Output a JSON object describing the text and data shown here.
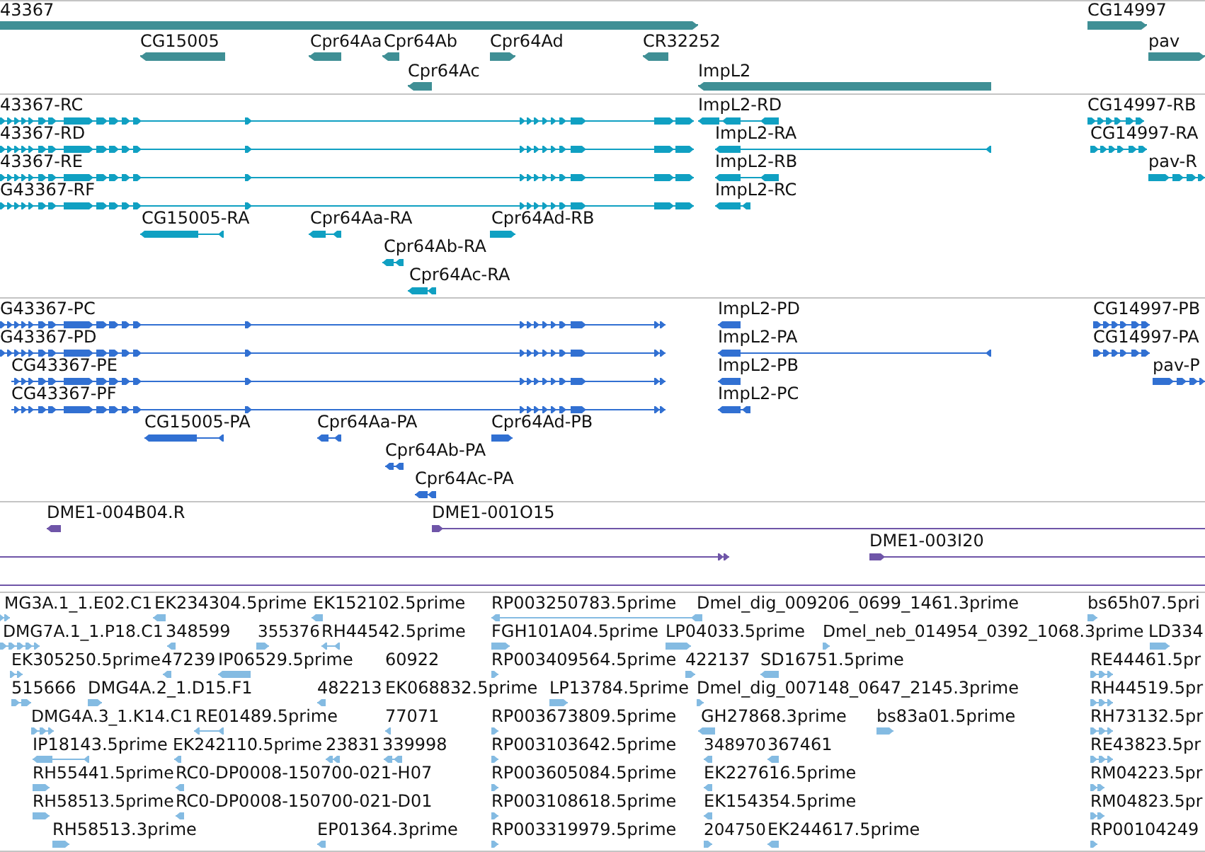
{
  "tracks": [
    {
      "color": "#3f8f95",
      "features": [
        {
          "label": "43367",
          "reverse": false
        },
        {
          "label": "CG14997",
          "reverse": false
        },
        {
          "label": "CG15005",
          "reverse": true
        },
        {
          "label": "Cpr64Aa",
          "reverse": true
        },
        {
          "label": "Cpr64Ab",
          "reverse": true
        },
        {
          "label": "Cpr64Ad",
          "reverse": false
        },
        {
          "label": "CR32252",
          "reverse": true
        },
        {
          "label": "pav",
          "reverse": false
        },
        {
          "label": "Cpr64Ac",
          "reverse": true
        },
        {
          "label": "ImpL2",
          "reverse": true
        }
      ]
    },
    {
      "color": "#10a0c2",
      "features": [
        {
          "label": "43367-RC",
          "reverse": false
        },
        {
          "label": "ImpL2-RD",
          "reverse": true
        },
        {
          "label": "CG14997-RB",
          "reverse": false
        },
        {
          "label": "43367-RD",
          "reverse": false
        },
        {
          "label": "ImpL2-RA",
          "reverse": true
        },
        {
          "label": "CG14997-RA",
          "reverse": false
        },
        {
          "label": "43367-RE",
          "reverse": false
        },
        {
          "label": "ImpL2-RB",
          "reverse": true
        },
        {
          "label": "pav-R",
          "reverse": false
        },
        {
          "label": "G43367-RF",
          "reverse": false
        },
        {
          "label": "ImpL2-RC",
          "reverse": true
        },
        {
          "label": "CG15005-RA",
          "reverse": true
        },
        {
          "label": "Cpr64Aa-RA",
          "reverse": true
        },
        {
          "label": "Cpr64Ad-RB",
          "reverse": false
        },
        {
          "label": "Cpr64Ab-RA",
          "reverse": true
        },
        {
          "label": "Cpr64Ac-RA",
          "reverse": true
        }
      ]
    },
    {
      "color": "#3170d2",
      "features": [
        {
          "label": "G43367-PC",
          "reverse": false
        },
        {
          "label": "ImpL2-PD",
          "reverse": true
        },
        {
          "label": "CG14997-PB",
          "reverse": false
        },
        {
          "label": "G43367-PD",
          "reverse": false
        },
        {
          "label": "ImpL2-PA",
          "reverse": true
        },
        {
          "label": "CG14997-PA",
          "reverse": false
        },
        {
          "label": "CG43367-PE",
          "reverse": false
        },
        {
          "label": "ImpL2-PB",
          "reverse": true
        },
        {
          "label": "pav-P",
          "reverse": false
        },
        {
          "label": "CG43367-PF",
          "reverse": false
        },
        {
          "label": "ImpL2-PC",
          "reverse": true
        },
        {
          "label": "CG15005-PA",
          "reverse": true
        },
        {
          "label": "Cpr64Aa-PA",
          "reverse": true
        },
        {
          "label": "Cpr64Ad-PB",
          "reverse": false
        },
        {
          "label": "Cpr64Ab-PA",
          "reverse": true
        },
        {
          "label": "Cpr64Ac-PA",
          "reverse": true
        }
      ]
    },
    {
      "color": "#6f55a8",
      "features": [
        {
          "label": "DME1-004B04.R",
          "reverse": true
        },
        {
          "label": "DME1-001O15",
          "reverse": false
        },
        {
          "reverse": false
        },
        {
          "label": "DME1-003I20",
          "reverse": false
        }
      ]
    },
    {
      "color": "#84bbe2",
      "features": [
        {
          "label": "MG3A.1_1.E02.C1",
          "reverse": false
        },
        {
          "label": "EK234304.5prime",
          "reverse": true
        },
        {
          "label": "EK152102.5prime",
          "reverse": true
        },
        {
          "label": "RP003250783.5prime",
          "reverse": true
        },
        {
          "label": "Dmel_dig_009206_0699_1461.3prime",
          "reverse": true
        },
        {
          "label": "bs65h07.5pri",
          "reverse": false
        },
        {
          "label": "DMG7A.1_1.P18.C1",
          "reverse": false
        },
        {
          "label": "348599",
          "reverse": true
        },
        {
          "label": "355376",
          "reverse": false
        },
        {
          "label": "RH44542.5prime",
          "reverse": true
        },
        {
          "label": "FGH101A04.5prime",
          "reverse": false
        },
        {
          "label": "LP04033.5prime",
          "reverse": false
        },
        {
          "label": "Dmel_neb_014954_0392_1068.3prime",
          "reverse": false
        },
        {
          "label": "LD334",
          "reverse": false
        },
        {
          "label": "EK305250.5prime",
          "reverse": false
        },
        {
          "label": "47239",
          "reverse": true
        },
        {
          "label": "IP06529.5prime",
          "reverse": true
        },
        {
          "label": "60922"
        },
        {
          "label": "RP003409564.5prime",
          "reverse": false
        },
        {
          "label": "422137",
          "reverse": false
        },
        {
          "label": "SD16751.5prime",
          "reverse": true
        },
        {
          "label": "RE44461.5pr",
          "reverse": false
        },
        {
          "label": "515666",
          "reverse": false
        },
        {
          "label": "DMG4A.2_1.D15.F1",
          "reverse": false
        },
        {
          "label": "482213",
          "reverse": true
        },
        {
          "label": "EK068832.5prime"
        },
        {
          "label": "LP13784.5prime",
          "reverse": false
        },
        {
          "label": "Dmel_dig_007148_0647_2145.3prime",
          "reverse": false
        },
        {
          "label": "RH44519.5pr",
          "reverse": false
        },
        {
          "label": "DMG4A.3_1.K14.C1",
          "reverse": false
        },
        {
          "label": "RE01489.5prime",
          "reverse": true
        },
        {
          "label": "77071",
          "reverse": true
        },
        {
          "label": "RP003673809.5prime",
          "reverse": false
        },
        {
          "label": "GH27868.3prime",
          "reverse": true
        },
        {
          "label": "bs83a01.5prime",
          "reverse": false
        },
        {
          "label": "RH73132.5pr",
          "reverse": false
        },
        {
          "label": "IP18143.5prime",
          "reverse": true
        },
        {
          "label": "EK242110.5prime",
          "reverse": true
        },
        {
          "label": "23831",
          "reverse": true
        },
        {
          "label": "339998",
          "reverse": true
        },
        {
          "label": "RP003103642.5prime",
          "reverse": false
        },
        {
          "label": "348970",
          "reverse": true
        },
        {
          "label": "367461",
          "reverse": true
        },
        {
          "label": "RE43823.5pr",
          "reverse": false
        },
        {
          "label": "RH55441.5prime",
          "reverse": false
        },
        {
          "label": "RC0-DP0008-150700-021-H07",
          "reverse": true
        },
        {
          "label": "RP003605084.5prime",
          "reverse": false
        },
        {
          "label": "EK227616.5prime",
          "reverse": true
        },
        {
          "label": "RM04223.5pr",
          "reverse": false
        },
        {
          "label": "RH58513.5prime",
          "reverse": false
        },
        {
          "label": "RC0-DP0008-150700-021-D01",
          "reverse": true
        },
        {
          "label": "RP003108618.5prime",
          "reverse": false
        },
        {
          "label": "EK154354.5prime",
          "reverse": true
        },
        {
          "label": "RM04823.5pr",
          "reverse": false
        },
        {
          "label": "RH58513.3prime",
          "reverse": false
        },
        {
          "label": "EP01364.3prime",
          "reverse": true
        },
        {
          "label": "RP003319979.5prime",
          "reverse": false
        },
        {
          "label": "204750",
          "reverse": false
        },
        {
          "label": "EK244617.5prime",
          "reverse": true
        },
        {
          "label": "RP00104249",
          "reverse": false
        }
      ]
    }
  ]
}
